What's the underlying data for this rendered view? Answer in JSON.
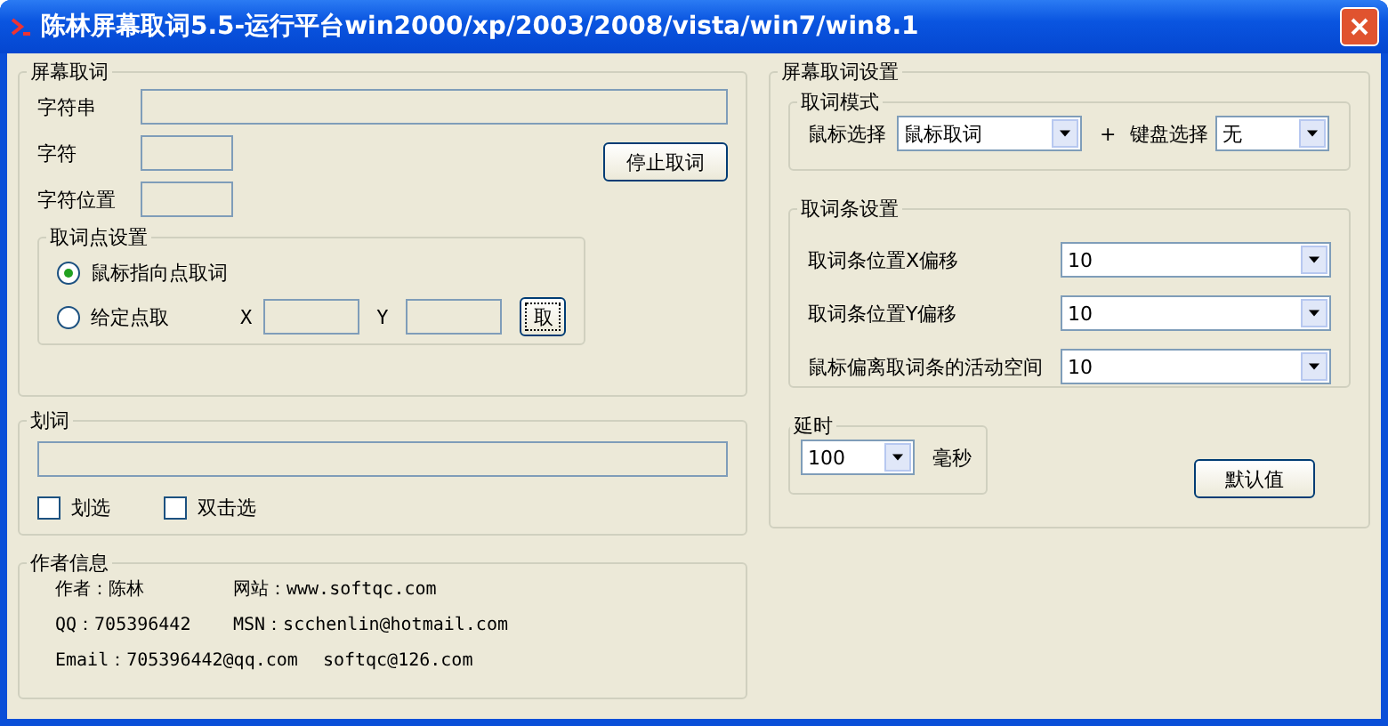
{
  "window": {
    "title": "陈林屏幕取词5.5-运行平台win2000/xp/2003/2008/vista/win7/win8.1"
  },
  "screen_capture": {
    "title": "屏幕取词",
    "fields": [
      {
        "label": "字符串",
        "kind": "wide"
      },
      {
        "label": "字符",
        "kind": "short"
      },
      {
        "label": "字符位置",
        "kind": "short"
      }
    ],
    "stop_button": "停止取词",
    "point_settings": {
      "title": "取词点设置",
      "options": [
        {
          "label": "鼠标指向点取词",
          "selected": true
        },
        {
          "label": "给定点取",
          "selected": false
        }
      ],
      "x_label": "X",
      "y_label": "Y",
      "pick_button": "取"
    }
  },
  "select_words": {
    "title": "划词",
    "checkboxes": [
      {
        "label": "划选",
        "checked": false
      },
      {
        "label": "双击选",
        "checked": false
      }
    ]
  },
  "author": {
    "title": "作者信息",
    "lines": [
      [
        "作者：陈林",
        "网站：www.softqc.com"
      ],
      [
        "QQ：705396442",
        "MSN：scchenlin@hotmail.com"
      ],
      [
        "Email：705396442@qq.com",
        "softqc@126.com"
      ]
    ]
  },
  "settings": {
    "title": "屏幕取词设置",
    "mode": {
      "title": "取词模式",
      "mouse_label": "鼠标选择",
      "mouse_value": "鼠标取词",
      "plus": "+",
      "keyboard_label": "键盘选择",
      "keyboard_value": "无"
    },
    "bar": {
      "title": "取词条设置",
      "rows": [
        {
          "label": "取词条位置X偏移",
          "value": "10"
        },
        {
          "label": "取词条位置Y偏移",
          "value": "10"
        },
        {
          "label": "鼠标偏离取词条的活动空间",
          "value": "10"
        }
      ]
    },
    "delay": {
      "title": "延时",
      "value": "100",
      "unit": "毫秒"
    },
    "default_button": "默认值"
  }
}
